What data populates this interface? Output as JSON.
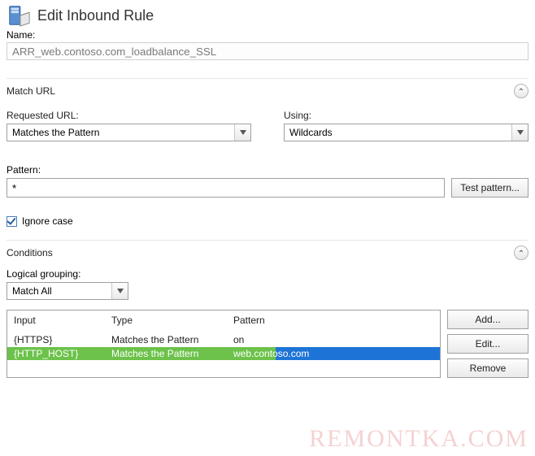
{
  "header": {
    "title": "Edit Inbound Rule"
  },
  "name_field": {
    "label": "Name:",
    "value": "ARR_web.contoso.com_loadbalance_SSL"
  },
  "match_url": {
    "section_title": "Match URL",
    "requested_label": "Requested URL:",
    "requested_value": "Matches the Pattern",
    "using_label": "Using:",
    "using_value": "Wildcards",
    "pattern_label": "Pattern:",
    "pattern_value": "*",
    "test_pattern_label": "Test pattern...",
    "ignore_case_label": "Ignore case",
    "ignore_case_checked": true
  },
  "conditions": {
    "section_title": "Conditions",
    "logical_label": "Logical grouping:",
    "logical_value": "Match All",
    "columns": {
      "input": "Input",
      "type": "Type",
      "pattern": "Pattern"
    },
    "rows": [
      {
        "input": "{HTTPS}",
        "type": "Matches the Pattern",
        "pattern": "on",
        "selected": false
      },
      {
        "input": "{HTTP_HOST}",
        "type": "Matches the Pattern",
        "pattern": "web.contoso.com",
        "selected": true
      }
    ],
    "buttons": {
      "add": "Add...",
      "edit": "Edit...",
      "remove": "Remove"
    }
  },
  "watermark": "REMONTKA.COM"
}
